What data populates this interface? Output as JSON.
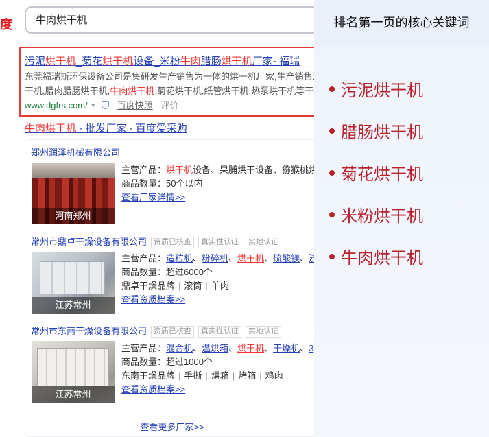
{
  "logo_fragment": "度",
  "search": {
    "value": "牛肉烘干机"
  },
  "result1": {
    "title_parts": [
      {
        "text": "污泥",
        "hl": false
      },
      {
        "text": "烘干机",
        "hl": true
      },
      {
        "text": "_菊花",
        "hl": false
      },
      {
        "text": "烘干机",
        "hl": true
      },
      {
        "text": "设备_米粉",
        "hl": false
      },
      {
        "text": "牛肉",
        "hl": true
      },
      {
        "text": "腊肠",
        "hl": false
      },
      {
        "text": "烘干机",
        "hl": true
      },
      {
        "text": "厂家- 福瑞",
        "hl": false
      }
    ],
    "desc_line1": "东莞福瑞斯环保设备公司是集研发生产销售为一体的烘干机厂家,生产销售:",
    "desc_line2_a": "干机,腊肉腊肠烘干机,",
    "desc_line2_hl": "牛肉烘干机",
    "desc_line2_b": ",菊花烘干机,纸管烘干机,热泵烘干机等干燥",
    "url": "www.dgfrs.com/",
    "snapshot": "百度快照",
    "rating_sep": "-",
    "rating": "- 评价"
  },
  "result2": {
    "title_parts": [
      {
        "text": "牛肉",
        "hl": true
      },
      {
        "text": "烘干机",
        "hl": true
      },
      {
        "text": " - 批发厂家 - 百度爱采购",
        "hl": false
      }
    ],
    "companies": [
      {
        "name": "郑州润泽机械有限公司",
        "badges": [],
        "photo_caption": "河南郑州",
        "main_label": "主营产品：",
        "products": [
          {
            "text": "烘干机",
            "hl": true,
            "link": false
          },
          {
            "text": "设备、果脯烘干设备、猕猴桃烘",
            "hl": false,
            "link": false
          }
        ],
        "count": "商品数量：50个以内",
        "tags": [],
        "link": "查看厂家详情>>"
      },
      {
        "name": "常州市鼎卓干燥设备有限公司",
        "badges": [
          "资质已核查",
          "真实性认证",
          "实地认证"
        ],
        "photo_caption": "江苏常州",
        "main_label": "主营产品：",
        "products": [
          {
            "text": "造粒机",
            "hl": false,
            "link": true
          },
          {
            "text": "、",
            "hl": false,
            "link": false
          },
          {
            "text": "粉碎机",
            "hl": false,
            "link": true
          },
          {
            "text": "、",
            "hl": false,
            "link": false
          },
          {
            "text": "烘干机",
            "hl": true,
            "link": true
          },
          {
            "text": "、",
            "hl": false,
            "link": false
          },
          {
            "text": "硫酸镁",
            "hl": false,
            "link": true
          },
          {
            "text": "、",
            "hl": false,
            "link": false
          },
          {
            "text": "沸",
            "hl": false,
            "link": true
          }
        ],
        "count": "商品数量：超过6000个",
        "tags": [
          "鼎卓干燥品牌",
          "滚筒",
          "羊肉"
        ],
        "link": "查看资质档案>>"
      },
      {
        "name": "常州市东南干燥设备有限公司",
        "badges": [
          "资质已核查",
          "真实性认证",
          "实地认证"
        ],
        "photo_caption": "江苏常州",
        "main_label": "主营产品：",
        "products": [
          {
            "text": "混合机",
            "hl": false,
            "link": true
          },
          {
            "text": "、",
            "hl": false,
            "link": false
          },
          {
            "text": "温烘箱",
            "hl": false,
            "link": true
          },
          {
            "text": "、",
            "hl": false,
            "link": false
          },
          {
            "text": "烘干机",
            "hl": true,
            "link": true
          },
          {
            "text": "、",
            "hl": false,
            "link": false
          },
          {
            "text": "干燥机",
            "hl": false,
            "link": true
          },
          {
            "text": "、",
            "hl": false,
            "link": false
          },
          {
            "text": "3",
            "hl": false,
            "link": true
          }
        ],
        "count": "商品数量：超过1000个",
        "tags": [
          "东南干燥品牌",
          "手撕",
          "烘箱",
          "烤箱",
          "鸡肉"
        ],
        "link": "查看资质档案>>"
      }
    ],
    "more": "查看更多厂家>>"
  },
  "keywords_panel": {
    "title": "排名第一页的核心关键词",
    "items": [
      "污泥烘干机",
      "腊肠烘干机",
      "菊花烘干机",
      "米粉烘干机",
      "牛肉烘干机"
    ]
  },
  "colors": {
    "highlight_red": "#f73131",
    "link_blue": "#2440b3",
    "keyword_red": "#b7212b",
    "result_border": "#e53935",
    "url_green": "#1e7c3a"
  }
}
